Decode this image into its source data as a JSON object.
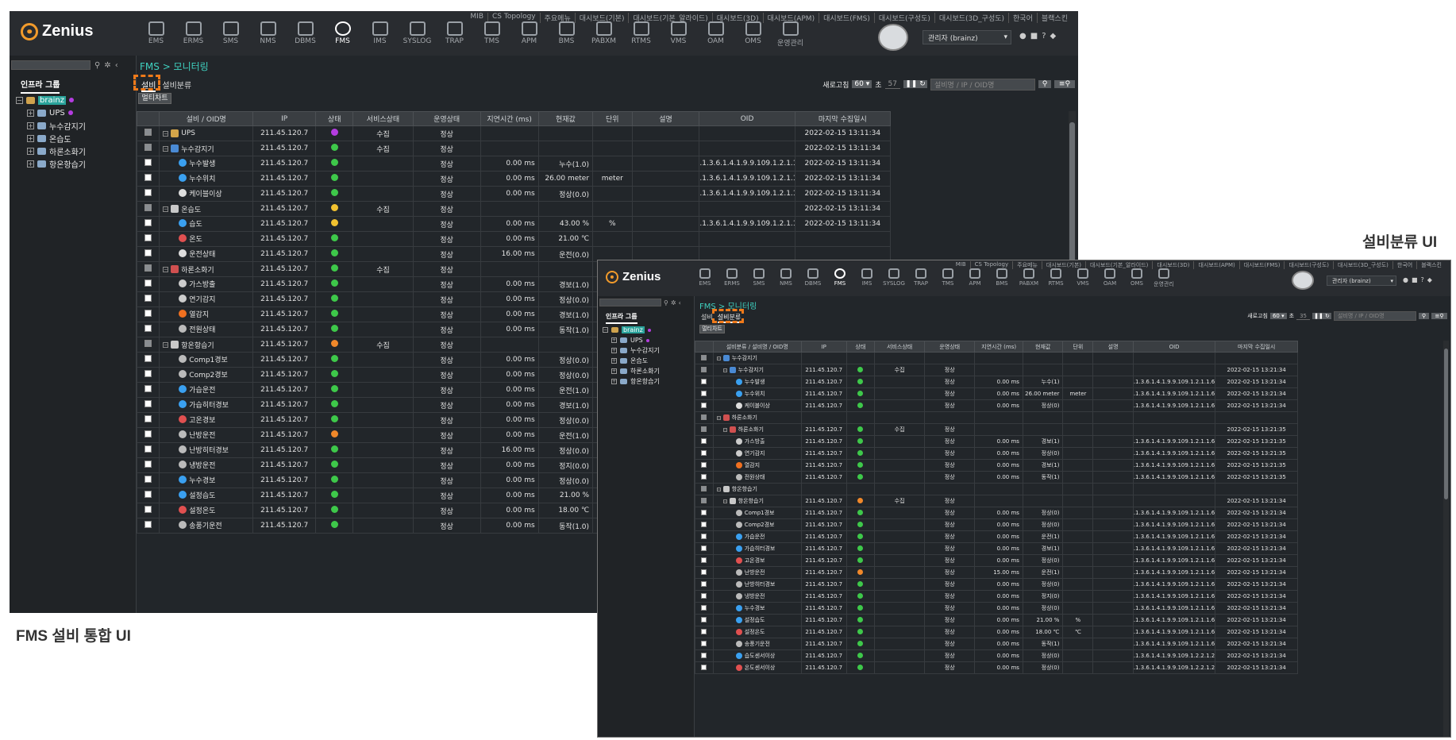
{
  "captions": {
    "left": "FMS 설비 통합 UI",
    "right": "설비분류 UI"
  },
  "colors": {
    "status_green": "#3ec84a",
    "status_yellow": "#f2c230",
    "status_orange": "#f0882a",
    "status_purple": "#b43ce0",
    "highlight": "#f07a1a",
    "teal": "#3fd0bf"
  },
  "app": {
    "logo": "Zenius",
    "top_menu": [
      "MIB",
      "CS Topology",
      "주요메뉴",
      "대시보드(기본)",
      "대시보드(기본_알라이드)",
      "대시보드(3D)",
      "대시보드(APM)",
      "대시보드(FMS)",
      "대시보드(구성도)",
      "대시보드(3D_구성도)",
      "한국어",
      "블랙스킨"
    ],
    "nav": [
      {
        "label": "EMS",
        "icon": "ems-icon"
      },
      {
        "label": "ERMS",
        "icon": "erms-icon"
      },
      {
        "label": "SMS",
        "icon": "sms-icon"
      },
      {
        "label": "NMS",
        "icon": "nms-icon"
      },
      {
        "label": "DBMS",
        "icon": "dbms-icon"
      },
      {
        "label": "FMS",
        "icon": "fms-icon"
      },
      {
        "label": "IMS",
        "icon": "ims-icon"
      },
      {
        "label": "SYSLOG",
        "icon": "syslog-icon"
      },
      {
        "label": "TRAP",
        "icon": "trap-icon"
      },
      {
        "label": "TMS",
        "icon": "tms-icon"
      },
      {
        "label": "APM",
        "icon": "apm-icon"
      },
      {
        "label": "BMS",
        "icon": "bms-icon"
      },
      {
        "label": "PABXM",
        "icon": "pabxm-icon"
      },
      {
        "label": "RTMS",
        "icon": "rtms-icon"
      },
      {
        "label": "VMS",
        "icon": "vms-icon"
      },
      {
        "label": "OAM",
        "icon": "oam-icon"
      },
      {
        "label": "OMS",
        "icon": "oms-icon"
      },
      {
        "label": "운영관리",
        "icon": "admin-gear-icon"
      }
    ],
    "user": "관리자 (brainz)",
    "sidebar_tab": "인프라 그룹",
    "tree": [
      {
        "label": "brainz",
        "root": true
      },
      {
        "label": "UPS",
        "dot": true
      },
      {
        "label": "누수감지기"
      },
      {
        "label": "온습도"
      },
      {
        "label": "하론소화기"
      },
      {
        "label": "항온항습기"
      }
    ],
    "breadcrumb": "FMS > 모니터링",
    "tabs": [
      "설비",
      "설비분류"
    ],
    "multichart": "멀티차트",
    "refresh_label": "새로고침",
    "refresh_value": "60",
    "refresh_unit": "초",
    "search_placeholder": "설비명 / IP / OID명"
  },
  "win_a": {
    "countdown": "57",
    "columns": [
      "설비 / OID명",
      "IP",
      "상태",
      "서비스상태",
      "운영상태",
      "지연시간 (ms)",
      "현재값",
      "단위",
      "설명",
      "OID",
      "마지막 수집일시"
    ],
    "rows": [
      {
        "lvl": 0,
        "name": "UPS",
        "ip": "211.45.120.7",
        "st": "purple",
        "svc": "수집",
        "op": "정상",
        "lat": "",
        "cur": "",
        "unit": "",
        "oid": "",
        "time": "2022-02-15 13:11:34",
        "grp": true,
        "ico": "#d4a54a"
      },
      {
        "lvl": 0,
        "name": "누수감지기",
        "ip": "211.45.120.7",
        "st": "green",
        "svc": "수집",
        "op": "정상",
        "lat": "",
        "cur": "",
        "unit": "",
        "oid": "",
        "time": "2022-02-15 13:11:34",
        "grp": true,
        "ico": "#4a8ad4"
      },
      {
        "lvl": 1,
        "name": "누수발생",
        "ip": "211.45.120.7",
        "st": "green",
        "svc": "",
        "op": "정상",
        "lat": "0.00 ms",
        "cur": "누수(1.0)",
        "unit": "",
        "oid": ".1.3.6.1.4.1.9.9.109.1.2.1.1.6.1",
        "time": "2022-02-15 13:11:34",
        "ico": "#3aa0f0"
      },
      {
        "lvl": 1,
        "name": "누수위치",
        "ip": "211.45.120.7",
        "st": "green",
        "svc": "",
        "op": "정상",
        "lat": "0.00 ms",
        "cur": "26.00 meter",
        "unit": "meter",
        "oid": ".1.3.6.1.4.1.9.9.109.1.2.1.1.6.1",
        "time": "2022-02-15 13:11:34",
        "ico": "#3aa0f0"
      },
      {
        "lvl": 1,
        "name": "케이블이상",
        "ip": "211.45.120.7",
        "st": "green",
        "svc": "",
        "op": "정상",
        "lat": "0.00 ms",
        "cur": "정상(0.0)",
        "unit": "",
        "oid": ".1.3.6.1.4.1.9.9.109.1.2.1.1.6.1",
        "time": "2022-02-15 13:11:34",
        "ico": "#dddddd"
      },
      {
        "lvl": 0,
        "name": "온습도",
        "ip": "211.45.120.7",
        "st": "yellow",
        "svc": "수집",
        "op": "정상",
        "lat": "",
        "cur": "",
        "unit": "",
        "oid": "",
        "time": "2022-02-15 13:11:34",
        "grp": true,
        "ico": "#c8c8c8"
      },
      {
        "lvl": 1,
        "name": "습도",
        "ip": "211.45.120.7",
        "st": "yellow",
        "svc": "",
        "op": "정상",
        "lat": "0.00 ms",
        "cur": "43.00 %",
        "unit": "%",
        "oid": ".1.3.6.1.4.1.9.9.109.1.2.1.1.6.1",
        "time": "2022-02-15 13:11:34",
        "ico": "#3aa0f0"
      },
      {
        "lvl": 1,
        "name": "온도",
        "ip": "211.45.120.7",
        "st": "green",
        "svc": "",
        "op": "정상",
        "lat": "0.00 ms",
        "cur": "21.00 ℃",
        "unit": "",
        "oid": "",
        "time": "",
        "ico": "#e05050"
      },
      {
        "lvl": 1,
        "name": "운전상태",
        "ip": "211.45.120.7",
        "st": "green",
        "svc": "",
        "op": "정상",
        "lat": "16.00 ms",
        "cur": "운전(0.0)",
        "unit": "",
        "oid": "",
        "time": "",
        "ico": "#dddddd"
      },
      {
        "lvl": 0,
        "name": "하론소화기",
        "ip": "211.45.120.7",
        "st": "green",
        "svc": "수집",
        "op": "정상",
        "lat": "",
        "cur": "",
        "unit": "",
        "oid": "",
        "time": "",
        "grp": true,
        "ico": "#d05050"
      },
      {
        "lvl": 1,
        "name": "가스방출",
        "ip": "211.45.120.7",
        "st": "green",
        "svc": "",
        "op": "정상",
        "lat": "0.00 ms",
        "cur": "경보(1.0)",
        "unit": "",
        "oid": "",
        "time": "",
        "ico": "#cccccc"
      },
      {
        "lvl": 1,
        "name": "연기감지",
        "ip": "211.45.120.7",
        "st": "green",
        "svc": "",
        "op": "정상",
        "lat": "0.00 ms",
        "cur": "정상(0.0)",
        "unit": "",
        "oid": "",
        "time": "",
        "ico": "#cccccc"
      },
      {
        "lvl": 1,
        "name": "열감지",
        "ip": "211.45.120.7",
        "st": "green",
        "svc": "",
        "op": "정상",
        "lat": "0.00 ms",
        "cur": "경보(1.0)",
        "unit": "",
        "oid": "",
        "time": "",
        "ico": "#f07020"
      },
      {
        "lvl": 1,
        "name": "전원상태",
        "ip": "211.45.120.7",
        "st": "green",
        "svc": "",
        "op": "정상",
        "lat": "0.00 ms",
        "cur": "동작(1.0)",
        "unit": "",
        "oid": "",
        "time": "",
        "ico": "#bbbbbb"
      },
      {
        "lvl": 0,
        "name": "항온항습기",
        "ip": "211.45.120.7",
        "st": "orange",
        "svc": "수집",
        "op": "정상",
        "lat": "",
        "cur": "",
        "unit": "",
        "oid": "",
        "time": "",
        "grp": true,
        "ico": "#c8c8c8"
      },
      {
        "lvl": 1,
        "name": "Comp1경보",
        "ip": "211.45.120.7",
        "st": "green",
        "svc": "",
        "op": "정상",
        "lat": "0.00 ms",
        "cur": "정상(0.0)",
        "unit": "",
        "oid": "",
        "time": "",
        "ico": "#bbbbbb"
      },
      {
        "lvl": 1,
        "name": "Comp2경보",
        "ip": "211.45.120.7",
        "st": "green",
        "svc": "",
        "op": "정상",
        "lat": "0.00 ms",
        "cur": "정상(0.0)",
        "unit": "",
        "oid": "",
        "time": "",
        "ico": "#bbbbbb"
      },
      {
        "lvl": 1,
        "name": "가습운전",
        "ip": "211.45.120.7",
        "st": "green",
        "svc": "",
        "op": "정상",
        "lat": "0.00 ms",
        "cur": "운전(1.0)",
        "unit": "",
        "oid": "",
        "time": "",
        "ico": "#3aa0f0"
      },
      {
        "lvl": 1,
        "name": "가습히터경보",
        "ip": "211.45.120.7",
        "st": "green",
        "svc": "",
        "op": "정상",
        "lat": "0.00 ms",
        "cur": "경보(1.0)",
        "unit": "",
        "oid": "",
        "time": "",
        "ico": "#3aa0f0"
      },
      {
        "lvl": 1,
        "name": "고온경보",
        "ip": "211.45.120.7",
        "st": "green",
        "svc": "",
        "op": "정상",
        "lat": "0.00 ms",
        "cur": "정상(0.0)",
        "unit": "",
        "oid": "",
        "time": "",
        "ico": "#e05050"
      },
      {
        "lvl": 1,
        "name": "난방운전",
        "ip": "211.45.120.7",
        "st": "orange",
        "svc": "",
        "op": "정상",
        "lat": "0.00 ms",
        "cur": "운전(1.0)",
        "unit": "",
        "oid": "",
        "time": "",
        "ico": "#bbbbbb"
      },
      {
        "lvl": 1,
        "name": "난방히터경보",
        "ip": "211.45.120.7",
        "st": "green",
        "svc": "",
        "op": "정상",
        "lat": "16.00 ms",
        "cur": "정상(0.0)",
        "unit": "",
        "oid": "",
        "time": "",
        "ico": "#bbbbbb"
      },
      {
        "lvl": 1,
        "name": "냉방운전",
        "ip": "211.45.120.7",
        "st": "green",
        "svc": "",
        "op": "정상",
        "lat": "0.00 ms",
        "cur": "정지(0.0)",
        "unit": "",
        "oid": "",
        "time": "",
        "ico": "#bbbbbb"
      },
      {
        "lvl": 1,
        "name": "누수경보",
        "ip": "211.45.120.7",
        "st": "green",
        "svc": "",
        "op": "정상",
        "lat": "0.00 ms",
        "cur": "정상(0.0)",
        "unit": "",
        "oid": "",
        "time": "",
        "ico": "#3aa0f0"
      },
      {
        "lvl": 1,
        "name": "설정습도",
        "ip": "211.45.120.7",
        "st": "green",
        "svc": "",
        "op": "정상",
        "lat": "0.00 ms",
        "cur": "21.00 %",
        "unit": "",
        "oid": "",
        "time": "",
        "ico": "#3aa0f0"
      },
      {
        "lvl": 1,
        "name": "설정온도",
        "ip": "211.45.120.7",
        "st": "green",
        "svc": "",
        "op": "정상",
        "lat": "0.00 ms",
        "cur": "18.00 ℃",
        "unit": "",
        "oid": "",
        "time": "",
        "ico": "#e05050"
      },
      {
        "lvl": 1,
        "name": "송풍기운전",
        "ip": "211.45.120.7",
        "st": "green",
        "svc": "",
        "op": "정상",
        "lat": "0.00 ms",
        "cur": "동작(1.0)",
        "unit": "",
        "oid": "",
        "time": "",
        "ico": "#bbbbbb"
      }
    ]
  },
  "win_b": {
    "countdown": "35",
    "columns": [
      "설비분류 / 설비명 / OID명",
      "IP",
      "상태",
      "서비스상태",
      "운영상태",
      "지연시간 (ms)",
      "현재값",
      "단위",
      "설명",
      "OID",
      "마지막 수집일시"
    ],
    "rows": [
      {
        "lvl": 0,
        "name": "누수감지기",
        "cat": true,
        "ip": "",
        "st": "",
        "svc": "",
        "op": "",
        "lat": "",
        "cur": "",
        "unit": "",
        "oid": "",
        "time": "",
        "ico": "#4a8ad4"
      },
      {
        "lvl": 1,
        "name": "누수감지기",
        "grp": true,
        "ip": "211.45.120.7",
        "st": "green",
        "svc": "수집",
        "op": "정상",
        "lat": "",
        "cur": "",
        "unit": "",
        "oid": "",
        "time": "2022-02-15 13:21:34",
        "ico": "#4a8ad4"
      },
      {
        "lvl": 2,
        "name": "누수발생",
        "ip": "211.45.120.7",
        "st": "green",
        "svc": "",
        "op": "정상",
        "lat": "0.00 ms",
        "cur": "누수(1)",
        "unit": "",
        "oid": ".1.3.6.1.4.1.9.9.109.1.2.1.1.6.1",
        "time": "2022-02-15 13:21:34",
        "ico": "#3aa0f0"
      },
      {
        "lvl": 2,
        "name": "누수위치",
        "ip": "211.45.120.7",
        "st": "green",
        "svc": "",
        "op": "정상",
        "lat": "0.00 ms",
        "cur": "26.00 meter",
        "unit": "meter",
        "oid": ".1.3.6.1.4.1.9.9.109.1.2.1.1.6.1",
        "time": "2022-02-15 13:21:34",
        "ico": "#3aa0f0"
      },
      {
        "lvl": 2,
        "name": "케이블이상",
        "ip": "211.45.120.7",
        "st": "green",
        "svc": "",
        "op": "정상",
        "lat": "0.00 ms",
        "cur": "정상(0)",
        "unit": "",
        "oid": ".1.3.6.1.4.1.9.9.109.1.2.1.1.6.1",
        "time": "2022-02-15 13:21:34",
        "ico": "#dddddd"
      },
      {
        "lvl": 0,
        "name": "하론소화기",
        "cat": true,
        "ip": "",
        "st": "",
        "svc": "",
        "op": "",
        "lat": "",
        "cur": "",
        "unit": "",
        "oid": "",
        "time": "",
        "ico": "#d05050"
      },
      {
        "lvl": 1,
        "name": "하론소화기",
        "grp": true,
        "ip": "211.45.120.7",
        "st": "green",
        "svc": "수집",
        "op": "정상",
        "lat": "",
        "cur": "",
        "unit": "",
        "oid": "",
        "time": "2022-02-15 13:21:35",
        "ico": "#d05050"
      },
      {
        "lvl": 2,
        "name": "가스방출",
        "ip": "211.45.120.7",
        "st": "green",
        "svc": "",
        "op": "정상",
        "lat": "0.00 ms",
        "cur": "경보(1)",
        "unit": "",
        "oid": ".1.3.6.1.4.1.9.9.109.1.2.1.1.6.1",
        "time": "2022-02-15 13:21:35",
        "ico": "#cccccc"
      },
      {
        "lvl": 2,
        "name": "연기감지",
        "ip": "211.45.120.7",
        "st": "green",
        "svc": "",
        "op": "정상",
        "lat": "0.00 ms",
        "cur": "정상(0)",
        "unit": "",
        "oid": ".1.3.6.1.4.1.9.9.109.1.2.1.1.6.1",
        "time": "2022-02-15 13:21:35",
        "ico": "#cccccc"
      },
      {
        "lvl": 2,
        "name": "열감지",
        "ip": "211.45.120.7",
        "st": "green",
        "svc": "",
        "op": "정상",
        "lat": "0.00 ms",
        "cur": "경보(1)",
        "unit": "",
        "oid": ".1.3.6.1.4.1.9.9.109.1.2.1.1.6.1",
        "time": "2022-02-15 13:21:35",
        "ico": "#f07020"
      },
      {
        "lvl": 2,
        "name": "전원상태",
        "ip": "211.45.120.7",
        "st": "green",
        "svc": "",
        "op": "정상",
        "lat": "0.00 ms",
        "cur": "동작(1)",
        "unit": "",
        "oid": ".1.3.6.1.4.1.9.9.109.1.2.1.1.6.1",
        "time": "2022-02-15 13:21:35",
        "ico": "#bbbbbb"
      },
      {
        "lvl": 0,
        "name": "항온항습기",
        "cat": true,
        "ip": "",
        "st": "",
        "svc": "",
        "op": "",
        "lat": "",
        "cur": "",
        "unit": "",
        "oid": "",
        "time": "",
        "ico": "#c8c8c8"
      },
      {
        "lvl": 1,
        "name": "항온항습기",
        "grp": true,
        "ip": "211.45.120.7",
        "st": "orange",
        "svc": "수집",
        "op": "정상",
        "lat": "",
        "cur": "",
        "unit": "",
        "oid": "",
        "time": "2022-02-15 13:21:34",
        "ico": "#c8c8c8"
      },
      {
        "lvl": 2,
        "name": "Comp1경보",
        "ip": "211.45.120.7",
        "st": "green",
        "svc": "",
        "op": "정상",
        "lat": "0.00 ms",
        "cur": "정상(0)",
        "unit": "",
        "oid": ".1.3.6.1.4.1.9.9.109.1.2.1.1.6.1",
        "time": "2022-02-15 13:21:34",
        "ico": "#bbbbbb"
      },
      {
        "lvl": 2,
        "name": "Comp2경보",
        "ip": "211.45.120.7",
        "st": "green",
        "svc": "",
        "op": "정상",
        "lat": "0.00 ms",
        "cur": "정상(0)",
        "unit": "",
        "oid": ".1.3.6.1.4.1.9.9.109.1.2.1.1.6.1",
        "time": "2022-02-15 13:21:34",
        "ico": "#bbbbbb"
      },
      {
        "lvl": 2,
        "name": "가습운전",
        "ip": "211.45.120.7",
        "st": "green",
        "svc": "",
        "op": "정상",
        "lat": "0.00 ms",
        "cur": "운전(1)",
        "unit": "",
        "oid": ".1.3.6.1.4.1.9.9.109.1.2.1.1.6.1",
        "time": "2022-02-15 13:21:34",
        "ico": "#3aa0f0"
      },
      {
        "lvl": 2,
        "name": "가습히터경보",
        "ip": "211.45.120.7",
        "st": "green",
        "svc": "",
        "op": "정상",
        "lat": "0.00 ms",
        "cur": "경보(1)",
        "unit": "",
        "oid": ".1.3.6.1.4.1.9.9.109.1.2.1.1.6.1",
        "time": "2022-02-15 13:21:34",
        "ico": "#3aa0f0"
      },
      {
        "lvl": 2,
        "name": "고온경보",
        "ip": "211.45.120.7",
        "st": "green",
        "svc": "",
        "op": "정상",
        "lat": "0.00 ms",
        "cur": "정상(0)",
        "unit": "",
        "oid": ".1.3.6.1.4.1.9.9.109.1.2.1.1.6.1",
        "time": "2022-02-15 13:21:34",
        "ico": "#e05050"
      },
      {
        "lvl": 2,
        "name": "난방운전",
        "ip": "211.45.120.7",
        "st": "orange",
        "svc": "",
        "op": "정상",
        "lat": "15.00 ms",
        "cur": "운전(1)",
        "unit": "",
        "oid": ".1.3.6.1.4.1.9.9.109.1.2.1.1.6.1",
        "time": "2022-02-15 13:21:34",
        "ico": "#bbbbbb"
      },
      {
        "lvl": 2,
        "name": "난방히터경보",
        "ip": "211.45.120.7",
        "st": "green",
        "svc": "",
        "op": "정상",
        "lat": "0.00 ms",
        "cur": "정상(0)",
        "unit": "",
        "oid": ".1.3.6.1.4.1.9.9.109.1.2.1.1.6.1",
        "time": "2022-02-15 13:21:34",
        "ico": "#bbbbbb"
      },
      {
        "lvl": 2,
        "name": "냉방운전",
        "ip": "211.45.120.7",
        "st": "green",
        "svc": "",
        "op": "정상",
        "lat": "0.00 ms",
        "cur": "정지(0)",
        "unit": "",
        "oid": ".1.3.6.1.4.1.9.9.109.1.2.1.1.6.1",
        "time": "2022-02-15 13:21:34",
        "ico": "#bbbbbb"
      },
      {
        "lvl": 2,
        "name": "누수경보",
        "ip": "211.45.120.7",
        "st": "green",
        "svc": "",
        "op": "정상",
        "lat": "0.00 ms",
        "cur": "정상(0)",
        "unit": "",
        "oid": ".1.3.6.1.4.1.9.9.109.1.2.1.1.6.1",
        "time": "2022-02-15 13:21:34",
        "ico": "#3aa0f0"
      },
      {
        "lvl": 2,
        "name": "설정습도",
        "ip": "211.45.120.7",
        "st": "green",
        "svc": "",
        "op": "정상",
        "lat": "0.00 ms",
        "cur": "21.00 %",
        "unit": "%",
        "oid": ".1.3.6.1.4.1.9.9.109.1.2.1.1.6.1",
        "time": "2022-02-15 13:21:34",
        "ico": "#3aa0f0"
      },
      {
        "lvl": 2,
        "name": "설정온도",
        "ip": "211.45.120.7",
        "st": "green",
        "svc": "",
        "op": "정상",
        "lat": "0.00 ms",
        "cur": "18.00 ℃",
        "unit": "℃",
        "oid": ".1.3.6.1.4.1.9.9.109.1.2.1.1.6.1",
        "time": "2022-02-15 13:21:34",
        "ico": "#e05050"
      },
      {
        "lvl": 2,
        "name": "송풍기운전",
        "ip": "211.45.120.7",
        "st": "green",
        "svc": "",
        "op": "정상",
        "lat": "0.00 ms",
        "cur": "동작(1)",
        "unit": "",
        "oid": ".1.3.6.1.4.1.9.9.109.1.2.1.1.6.1",
        "time": "2022-02-15 13:21:34",
        "ico": "#bbbbbb"
      },
      {
        "lvl": 2,
        "name": "습도센서이상",
        "ip": "211.45.120.7",
        "st": "green",
        "svc": "",
        "op": "정상",
        "lat": "0.00 ms",
        "cur": "정상(0)",
        "unit": "",
        "oid": ".1.3.6.1.4.1.9.9.109.1.2.2.1.2.1",
        "time": "2022-02-15 13:21:34",
        "ico": "#3aa0f0"
      },
      {
        "lvl": 2,
        "name": "온도센서이상",
        "ip": "211.45.120.7",
        "st": "green",
        "svc": "",
        "op": "정상",
        "lat": "0.00 ms",
        "cur": "정상(0)",
        "unit": "",
        "oid": ".1.3.6.1.4.1.9.9.109.1.2.2.1.2.1",
        "time": "2022-02-15 13:21:34",
        "ico": "#e05050"
      }
    ]
  }
}
